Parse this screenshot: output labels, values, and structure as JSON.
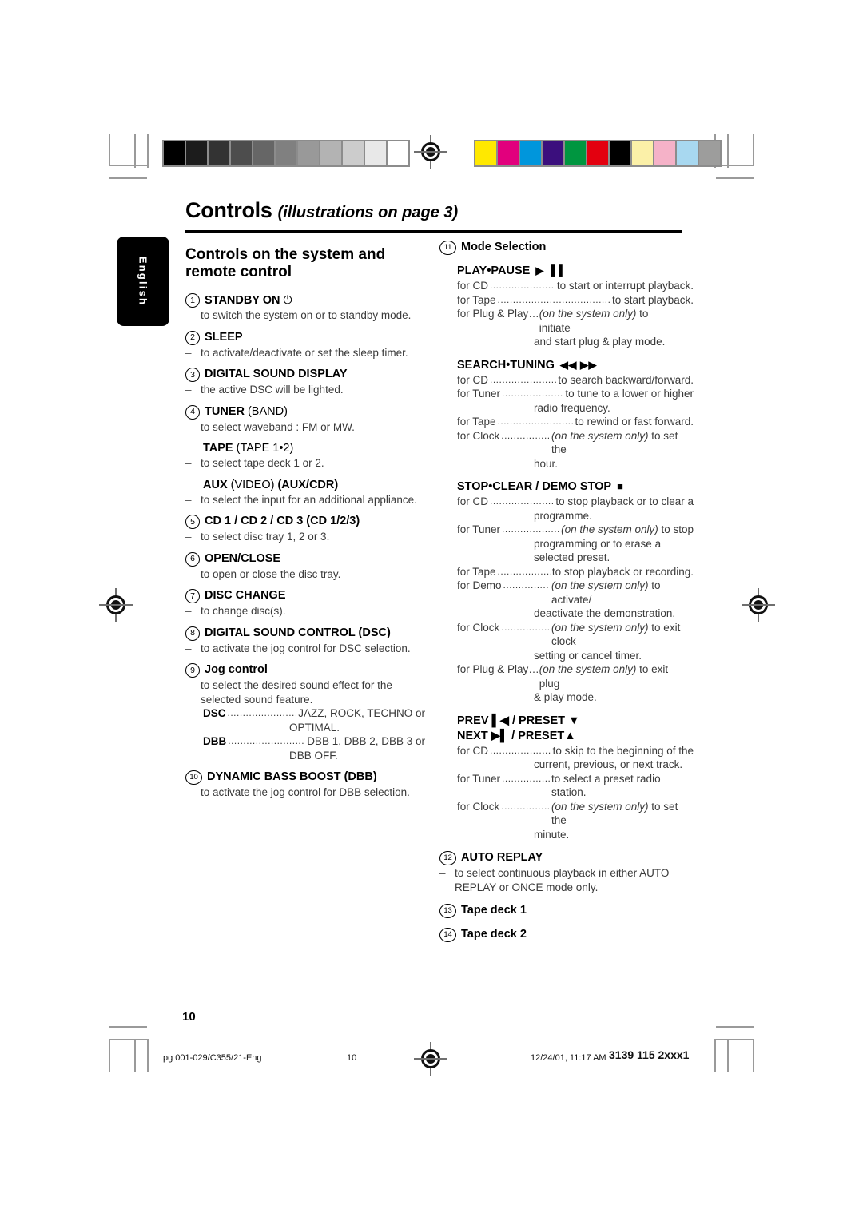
{
  "print_marks": {
    "grayscale_bar": [
      "#000000",
      "#1c1c1c",
      "#333333",
      "#4d4d4d",
      "#666666",
      "#808080",
      "#999999",
      "#b3b3b3",
      "#cccccc",
      "#e8e8e8",
      "#ffffff"
    ],
    "color_bar": [
      "#ffe800",
      "#e2007d",
      "#0096dc",
      "#3b0f7d",
      "#009640",
      "#e3000f",
      "#000000",
      "#fbf0a8",
      "#f5b2c8",
      "#a8d8f0",
      "#9d9d9c"
    ]
  },
  "header": {
    "title": "Controls",
    "subtitle": "(illustrations on page 3)"
  },
  "language_tab": "English",
  "left_column": {
    "section_heading": "Controls on the system and remote control",
    "entries": [
      {
        "num": "1",
        "head": "STANDBY ON",
        "head_suffix": "⏻",
        "lines": [
          "to switch the system on or to standby mode."
        ]
      },
      {
        "num": "2",
        "head": "SLEEP",
        "lines": [
          "to activate/deactivate or set the sleep timer."
        ]
      },
      {
        "num": "3",
        "head": "DIGITAL SOUND DISPLAY",
        "lines": [
          "the active DSC will be lighted."
        ]
      },
      {
        "num": "4",
        "head": "TUNER",
        "head_light": "(BAND)",
        "lines": [
          "to select waveband : FM or MW."
        ]
      },
      {
        "num": "",
        "head": "TAPE",
        "head_light": "(TAPE 1•2)",
        "lines": [
          "to select tape deck 1 or 2."
        ]
      },
      {
        "num": "",
        "head": "AUX",
        "head_light": "(VIDEO)",
        "head_bold_tail": "(AUX/CDR)",
        "lines": [
          "to select the input for an additional appliance."
        ]
      },
      {
        "num": "5",
        "head": "CD 1 / CD 2 / CD 3 (CD 1/2/3)",
        "lines": [
          "to select disc tray 1, 2 or 3."
        ]
      },
      {
        "num": "6",
        "head": "OPEN/CLOSE",
        "lines": [
          "to open or close the disc tray."
        ]
      },
      {
        "num": "7",
        "head": "DISC CHANGE",
        "lines": [
          "to change disc(s)."
        ]
      },
      {
        "num": "8",
        "head": "DIGITAL SOUND CONTROL (DSC)",
        "lines": [
          "to activate the jog control for DSC selection."
        ]
      },
      {
        "num": "9",
        "head": "Jog control",
        "head_style": "mixed",
        "lines": [
          "to select the desired sound effect for the selected sound feature."
        ]
      },
      {
        "num": "10",
        "head": "DYNAMIC BASS BOOST (DBB)",
        "lines": [
          "to activate the jog control for DBB selection."
        ]
      }
    ],
    "jog_leaders": [
      {
        "label": "DSC",
        "value": "JAZZ, ROCK, TECHNO or",
        "cont": "OPTIMAL."
      },
      {
        "label": "DBB",
        "value": "DBB 1, DBB 2, DBB 3 or",
        "cont": "DBB OFF."
      }
    ]
  },
  "right_column": {
    "entry_11": {
      "num": "11",
      "head": "Mode Selection",
      "groups": [
        {
          "head": "PLAY•PAUSE",
          "glyph": "▶ ▐▐",
          "rows": [
            {
              "label": "for CD",
              "value": "to start or interrupt playback."
            },
            {
              "label": "for Tape",
              "value": "to start playback."
            },
            {
              "label": "for Plug & Play…",
              "no_dots": true,
              "italic": "(on the system only)",
              "value": " to initiate",
              "cont": "and start plug & play mode."
            }
          ]
        },
        {
          "head": "SEARCH•TUNING",
          "glyph": "◀◀  ▶▶",
          "rows": [
            {
              "label": "for CD",
              "value": "to search backward/forward."
            },
            {
              "label": "for Tuner",
              "value": "to tune to a lower or higher",
              "cont": "radio frequency."
            },
            {
              "label": "for Tape",
              "value": "to rewind or fast forward."
            },
            {
              "label": "for Clock",
              "italic": "(on the system only)",
              "value": " to set the",
              "cont": "hour."
            }
          ]
        },
        {
          "head": "STOP•CLEAR / DEMO STOP",
          "glyph": "■",
          "rows": [
            {
              "label": "for CD",
              "value": "to stop playback or to clear a",
              "cont": "programme."
            },
            {
              "label": "for Tuner",
              "italic": "(on the system only)",
              "value": " to stop",
              "cont": "programming or to erase a",
              "cont2": "selected preset."
            },
            {
              "label": "for Tape",
              "value": "to stop playback or recording."
            },
            {
              "label": "for Demo",
              "italic": "(on the system only)",
              "value": " to activate/",
              "cont": "deactivate the demonstration."
            },
            {
              "label": "for Clock",
              "italic": "(on the system only)",
              "value": " to exit clock",
              "cont": "setting or cancel timer."
            },
            {
              "label": "for Plug & Play…",
              "no_dots": true,
              "italic": "(on the system only)",
              "value": " to exit plug",
              "cont": "& play mode."
            }
          ]
        },
        {
          "head": "PREV ▌◀ / PRESET ▼",
          "head2": "NEXT ▶▌ / PRESET▲",
          "rows": [
            {
              "label": "for CD",
              "value": "to skip to the beginning of the",
              "cont": "current, previous, or next track."
            },
            {
              "label": "for Tuner",
              "value": "to select a preset radio station."
            },
            {
              "label": "for Clock",
              "italic": "(on the system only)",
              "value": " to set the",
              "cont": "minute."
            }
          ]
        }
      ]
    },
    "entry_12": {
      "num": "12",
      "head": "AUTO REPLAY",
      "lines": [
        "to select continuous playback in either AUTO REPLAY or ONCE mode only."
      ]
    },
    "entry_13": {
      "num": "13",
      "head": "Tape deck 1"
    },
    "entry_14": {
      "num": "14",
      "head": "Tape deck 2"
    }
  },
  "page_number": "10",
  "footer": {
    "left": "pg 001-029/C355/21-Eng",
    "center": "10",
    "timestamp": "12/24/01, 11:17 AM",
    "doc_code": "3139 115 2xxx1"
  }
}
